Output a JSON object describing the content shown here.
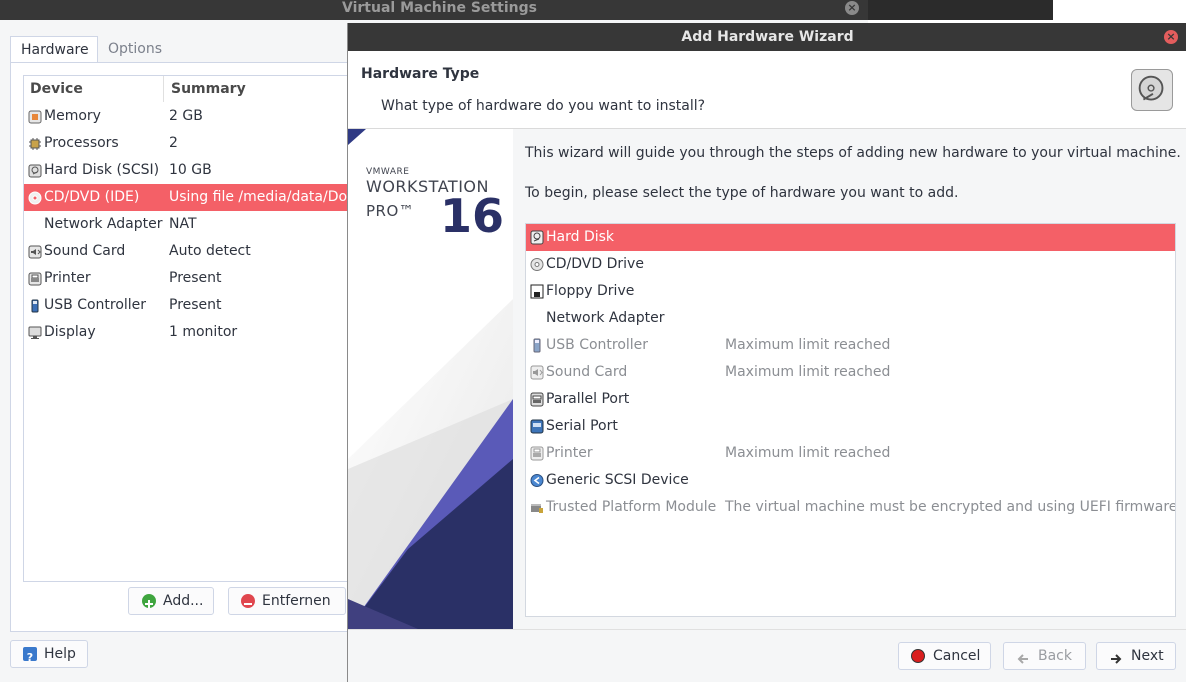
{
  "vm_settings": {
    "title": "Virtual Machine Settings",
    "close_glyph": "×",
    "tabs": [
      {
        "label": "Hardware"
      },
      {
        "label": "Options"
      }
    ],
    "columns": {
      "device": "Device",
      "summary": "Summary"
    },
    "devices": [
      {
        "name": "Memory",
        "summary": "2 GB",
        "icon": "memory-icon"
      },
      {
        "name": "Processors",
        "summary": "2",
        "icon": "processor-icon"
      },
      {
        "name": "Hard Disk (SCSI)",
        "summary": "10 GB",
        "icon": "hard-disk-icon"
      },
      {
        "name": "CD/DVD (IDE)",
        "summary": "Using file /media/data/Do",
        "icon": "cd-dvd-icon"
      },
      {
        "name": "Network Adapter",
        "summary": "NAT",
        "icon": "network-icon"
      },
      {
        "name": "Sound Card",
        "summary": "Auto detect",
        "icon": "sound-card-icon"
      },
      {
        "name": "Printer",
        "summary": "Present",
        "icon": "printer-icon"
      },
      {
        "name": "USB Controller",
        "summary": "Present",
        "icon": "usb-icon"
      },
      {
        "name": "Display",
        "summary": "1 monitor",
        "icon": "display-icon"
      }
    ],
    "selected_device": "CD/DVD (IDE)",
    "add_label": "Add...",
    "remove_label": "Entfernen",
    "help_label": "Help"
  },
  "wizard": {
    "title": "Add Hardware Wizard",
    "close_glyph": "×",
    "header_title": "Hardware Type",
    "header_subtitle": "What type of hardware do you want to install?",
    "brand": {
      "vmware": "VMWARE",
      "product": "WORKSTATION",
      "edition": "PRO™",
      "version": "16"
    },
    "intro1": "This wizard will guide you through the steps of adding new hardware to your virtual machine.",
    "intro2": "To begin, please select the type of hardware you want to add.",
    "hardware_types": [
      {
        "name": "Hard Disk",
        "status": "",
        "icon": "hard-disk-icon"
      },
      {
        "name": "CD/DVD Drive",
        "status": "",
        "icon": "cd-dvd-icon"
      },
      {
        "name": "Floppy Drive",
        "status": "",
        "icon": "floppy-icon"
      },
      {
        "name": "Network Adapter",
        "status": "",
        "icon": "network-icon"
      },
      {
        "name": "USB Controller",
        "status": "Maximum limit reached",
        "icon": "usb-icon"
      },
      {
        "name": "Sound Card",
        "status": "Maximum limit reached",
        "icon": "sound-card-icon"
      },
      {
        "name": "Parallel Port",
        "status": "",
        "icon": "parallel-port-icon"
      },
      {
        "name": "Serial Port",
        "status": "",
        "icon": "serial-port-icon"
      },
      {
        "name": "Printer",
        "status": "Maximum limit reached",
        "icon": "printer-icon"
      },
      {
        "name": "Generic SCSI Device",
        "status": "",
        "icon": "scsi-icon"
      },
      {
        "name": "Trusted Platform Module",
        "status": "The virtual machine must be encrypted and using UEFI firmware.",
        "icon": "tpm-icon"
      }
    ],
    "selected_type": "Hard Disk",
    "cancel_label": "Cancel",
    "back_label": "Back",
    "next_label": "Next"
  },
  "colors": {
    "selection": "#f46067",
    "titlebar": "#373737",
    "brand_blue": "#2a3066",
    "accent_purple": "#4f4fb8"
  }
}
